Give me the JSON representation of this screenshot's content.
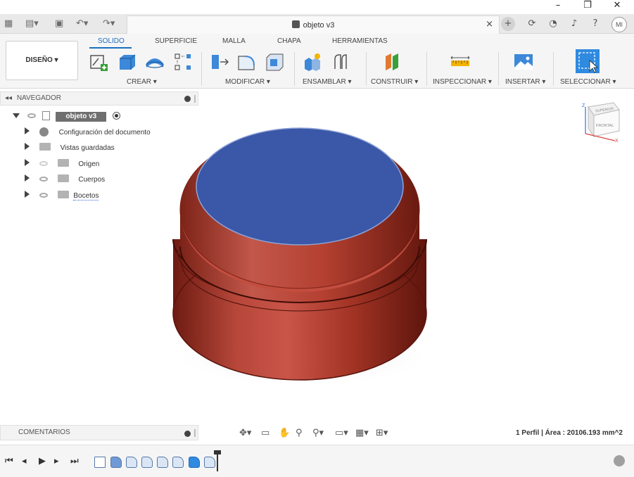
{
  "window": {
    "minimize_glyph": "–",
    "restore_glyph": "❐",
    "close_glyph": "✕"
  },
  "app_bar": {
    "document_title": "objeto v3",
    "tab_close_glyph": "×",
    "avatar_initials": "MI",
    "icons": [
      "grid-icon",
      "file-icon",
      "save-icon",
      "undo-icon",
      "redo-icon",
      "new-tab-icon",
      "extensions-icon",
      "job-status-icon",
      "notifications-icon",
      "help-icon"
    ]
  },
  "toolbar": {
    "workspace_label": "DISEÑO ▾",
    "tabs": [
      "SOLIDO",
      "SUPERFICIE",
      "MALLA",
      "CHAPA",
      "HERRAMIENTAS"
    ],
    "active_tab": "SOLIDO",
    "groups": [
      "CREAR ▾",
      "MODIFICAR ▾",
      "ENSAMBLAR ▾",
      "CONSTRUIR ▾",
      "INSPECCIONAR ▾",
      "INSERTAR ▾",
      "SELECCIONAR ▾"
    ]
  },
  "browser": {
    "header": "NAVEGADOR",
    "root": "objeto v3",
    "items": [
      {
        "label": "Configuración del documento"
      },
      {
        "label": "Vistas guardadas"
      },
      {
        "label": "Origen"
      },
      {
        "label": "Cuerpos"
      },
      {
        "label": "Bocetos"
      }
    ]
  },
  "viewcube": {
    "top_label": "SUPERIOR",
    "front_label": "FRONTAL",
    "axis_z": "Z",
    "axis_x": "X"
  },
  "comments": {
    "label": "COMENTARIOS"
  },
  "status": {
    "text": "1 Perfil | Área : 20106.193 mm^2"
  },
  "colors": {
    "accent": "#1a6fbf",
    "body_red": "#a83226",
    "face_blue": "#3a57a8",
    "selected_feature": "#2f8ae0"
  }
}
